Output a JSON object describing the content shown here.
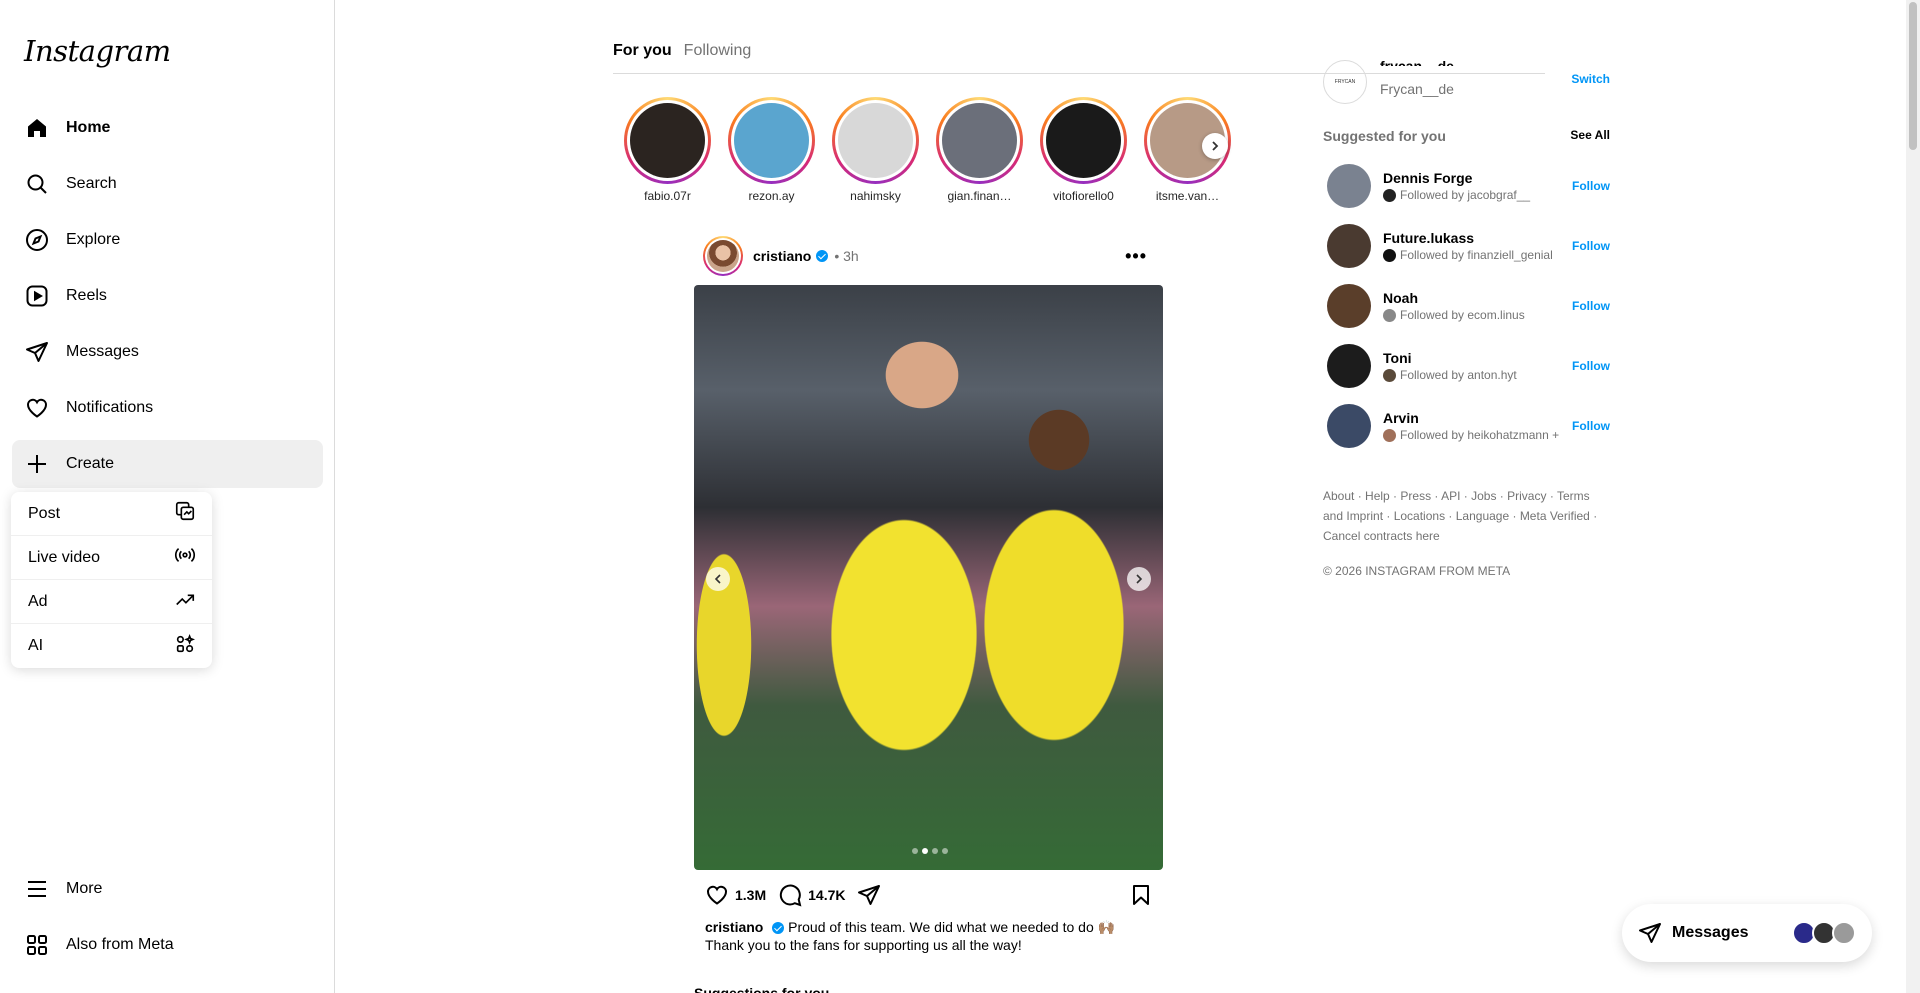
{
  "logo": "Instagram",
  "nav": {
    "home": "Home",
    "search": "Search",
    "explore": "Explore",
    "reels": "Reels",
    "messages": "Messages",
    "notifications": "Notifications",
    "create": "Create",
    "more": "More",
    "meta": "Also from Meta"
  },
  "create_menu": {
    "post": "Post",
    "live": "Live video",
    "ad": "Ad",
    "ai": "AI"
  },
  "feed_tabs": {
    "for_you": "For you",
    "following": "Following"
  },
  "stories": [
    {
      "name": "fabio.07r",
      "color": "#2b2420"
    },
    {
      "name": "rezon.ay",
      "color": "#5aa5cf"
    },
    {
      "name": "nahimsky",
      "color": "#d8d8d8"
    },
    {
      "name": "gian.finan…",
      "color": "#6b6f7a"
    },
    {
      "name": "vitofiorello0",
      "color": "#1a1a1a"
    },
    {
      "name": "itsme.van…",
      "color": "#b79a86"
    }
  ],
  "post": {
    "user": "cristiano",
    "time": "• 3h",
    "likes": "1.3M",
    "comments": "14.7K",
    "caption_user": "cristiano",
    "caption_text": "Proud of this team. We did what we needed to do 🙌🏽 Thank you to the fans for supporting us all the way!",
    "next_peek": "Suggestions for you"
  },
  "account": {
    "username": "frycan__de",
    "fullname": "Frycan__de",
    "avatar_text": "FRYCAN",
    "switch": "Switch"
  },
  "suggested": {
    "title": "Suggested for you",
    "see_all": "See All",
    "follow": "Follow",
    "items": [
      {
        "name": "Dennis Forge",
        "sub": "Followed by jacobgraf__",
        "color": "#7a8290",
        "dot": "#222"
      },
      {
        "name": "Future.lukass",
        "sub": "Followed by finanziell_genial",
        "color": "#4a3a30",
        "dot": "#111"
      },
      {
        "name": "Noah",
        "sub": "Followed by ecom.linus",
        "color": "#5a3e2a",
        "dot": "#888"
      },
      {
        "name": "Toni",
        "sub": "Followed by anton.hyt",
        "color": "#1c1c1c",
        "dot": "#5a4a3a"
      },
      {
        "name": "Arvin",
        "sub": "Followed by heikohatzmann +",
        "color": "#3b4a66",
        "dot": "#a0705a"
      }
    ]
  },
  "footer": {
    "links": [
      "About",
      "Help",
      "Press",
      "API",
      "Jobs",
      "Privacy",
      "Terms and Imprint",
      "Locations",
      "Language",
      "Meta Verified",
      "Cancel contracts here"
    ],
    "copyright": "© 2026 INSTAGRAM FROM META"
  },
  "messages_pill": {
    "label": "Messages",
    "avatar_colors": [
      "#2a2a8a",
      "#333333",
      "#9a9a9a"
    ]
  }
}
